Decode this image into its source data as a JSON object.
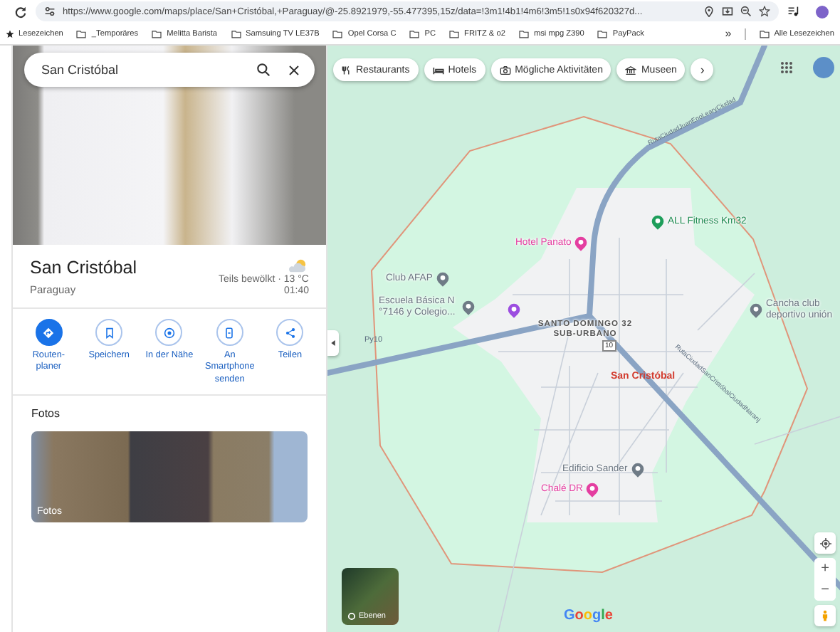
{
  "browser": {
    "url": "https://www.google.com/maps/place/San+Cristóbal,+Paraguay/@-25.8921979,-55.477395,15z/data=!3m1!4b1!4m6!3m5!1s0x94f620327d...",
    "bookmarks": [
      {
        "label": "Lesezeichen",
        "kind": "star"
      },
      {
        "label": "_Temporäres",
        "kind": "folder"
      },
      {
        "label": "Melitta Barista",
        "kind": "folder"
      },
      {
        "label": "Samsuing TV LE37B",
        "kind": "folder"
      },
      {
        "label": "Opel Corsa C",
        "kind": "folder"
      },
      {
        "label": "PC",
        "kind": "folder"
      },
      {
        "label": "FRITZ & o2",
        "kind": "folder"
      },
      {
        "label": "msi mpg Z390",
        "kind": "folder"
      },
      {
        "label": "PayPack",
        "kind": "folder"
      }
    ],
    "more": "»",
    "all_bookmarks": "Alle Lesezeichen"
  },
  "panel": {
    "search": {
      "value": "San Cristóbal"
    },
    "title": "San Cristóbal",
    "subtitle": "Paraguay",
    "weather": "Teils bewölkt · 13 °C",
    "time": "01:40",
    "actions": [
      {
        "label": "Routen-planer",
        "kind": "route",
        "primary": true
      },
      {
        "label": "Speichern",
        "kind": "save",
        "primary": false
      },
      {
        "label": "In der Nähe",
        "kind": "nearby",
        "primary": false
      },
      {
        "label": "An Smartphone senden",
        "kind": "phone",
        "primary": false
      },
      {
        "label": "Teilen",
        "kind": "share",
        "primary": false
      }
    ],
    "photos_heading": "Fotos",
    "photo_label": "Fotos"
  },
  "map": {
    "chips": [
      {
        "label": "Restaurants",
        "kind": "restaurant"
      },
      {
        "label": "Hotels",
        "kind": "hotel"
      },
      {
        "label": "Mögliche Aktivitäten",
        "kind": "camera"
      },
      {
        "label": "Museen",
        "kind": "museum"
      }
    ],
    "chips_next": "›",
    "places": [
      {
        "label": "Hotel Panato",
        "kind": "hotel"
      },
      {
        "label": "ALL Fitness Km32",
        "kind": "fitness"
      },
      {
        "label": "Club AFAP",
        "kind": "generic"
      },
      {
        "label": "Escuela Básica N °7146 y Colegio...",
        "kind": "school"
      },
      {
        "kind": "music"
      },
      {
        "label": "Cancha club deportivo unión",
        "kind": "generic"
      },
      {
        "label": "Edificio Sander",
        "kind": "generic"
      },
      {
        "label": "Chalé DR",
        "kind": "hotel"
      }
    ],
    "district": "SANTO DOMINGO 32 SUB-URBANO",
    "city": "San Cristóbal",
    "route_shield": "10",
    "roads": [
      "Py10",
      "RutaCiudadJuanEnoLearyCiudad",
      "RutaCiudadSanCristóbalCiudadNaranj"
    ],
    "layers": "Ebenen",
    "logo": "Google",
    "zoom_in": "+",
    "zoom_out": "−"
  }
}
